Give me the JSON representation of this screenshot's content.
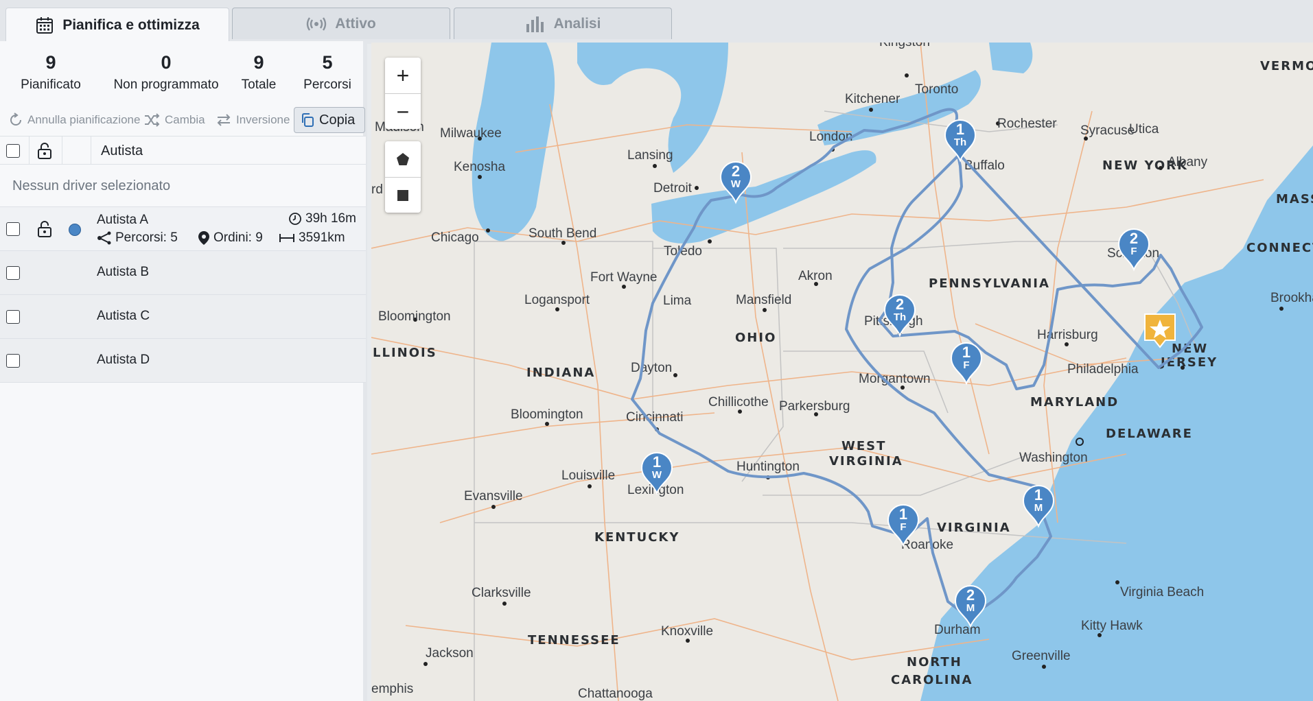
{
  "tabs": [
    {
      "label": "Pianifica e ottimizza",
      "icon": "calendar-icon"
    },
    {
      "label": "Attivo",
      "icon": "broadcast-icon"
    },
    {
      "label": "Analisi",
      "icon": "bar-chart-icon"
    }
  ],
  "stats": [
    {
      "value": "9",
      "label": "Pianificato"
    },
    {
      "value": "0",
      "label": "Non programmato"
    },
    {
      "value": "9",
      "label": "Totale"
    },
    {
      "value": "5",
      "label": "Percorsi"
    }
  ],
  "toolbar": {
    "unschedule": "Annulla pianificazione",
    "change": "Cambia",
    "reverse": "Inversione",
    "copy": "Copia"
  },
  "table": {
    "header": "Autista",
    "empty": "Nessun driver selezionato"
  },
  "drivers": [
    {
      "name": "Autista A",
      "time": "39h 16m",
      "routes": "Percorsi: 5",
      "orders": "Ordini: 9",
      "distance": "3591km",
      "color": "#4a86c5"
    },
    {
      "name": "Autista B"
    },
    {
      "name": "Autista C"
    },
    {
      "name": "Autista D"
    }
  ],
  "map": {
    "zoom_in": "+",
    "zoom_out": "−",
    "route_color": "#6f96c8",
    "pin_color": "#4a86c5",
    "depot_color": "#f0b43c",
    "states": [
      "VERMONT",
      "NEW YORK",
      "MASSA",
      "CONNECTI",
      "PENNSYLVANIA",
      "NEW",
      "JERSEY",
      "OHIO",
      "INDIANA",
      "LLINOIS",
      "MARYLAND",
      "DELAWARE",
      "WEST",
      "VIRGINIA",
      "VIRGINIA",
      "KENTUCKY",
      "TENNESSEE",
      "NORTH",
      "CAROLINA"
    ],
    "cities": [
      "Kingston",
      "Toronto",
      "Kitchener",
      "Rochester",
      "Syracuse",
      "Utica",
      "Albany",
      "London",
      "Buffalo",
      "Milwaukee",
      "Madison",
      "Kenosha",
      "Lansing",
      "Detroit",
      "Chicago",
      "South Bend",
      "Toledo",
      "Scranton",
      "Brookhaven",
      "Akron",
      "Fort Wayne",
      "Logansport",
      "Lima",
      "Mansfield",
      "Pittsburgh",
      "Harrisburg",
      "Bloomington",
      "Philadelphia",
      "Dayton",
      "Morgantown",
      "Bloomington",
      "Cincinnati",
      "Chillicothe",
      "Parkersburg",
      "Washington",
      "Louisville",
      "Evansville",
      "Lexington",
      "Huntington",
      "Roanoke",
      "Virginia Beach",
      "Clarksville",
      "Kitty Hawk",
      "Knoxville",
      "Durham",
      "Jackson",
      "Greenville",
      "Chattanooga",
      "emphis",
      "rd"
    ],
    "pins": [
      {
        "top": "1",
        "bottom": "Th"
      },
      {
        "top": "2",
        "bottom": "W"
      },
      {
        "top": "2",
        "bottom": "F"
      },
      {
        "top": "2",
        "bottom": "Th"
      },
      {
        "top": "1",
        "bottom": "F"
      },
      {
        "top": "1",
        "bottom": "W"
      },
      {
        "top": "1",
        "bottom": "F"
      },
      {
        "top": "1",
        "bottom": "M"
      },
      {
        "top": "2",
        "bottom": "M"
      }
    ]
  }
}
